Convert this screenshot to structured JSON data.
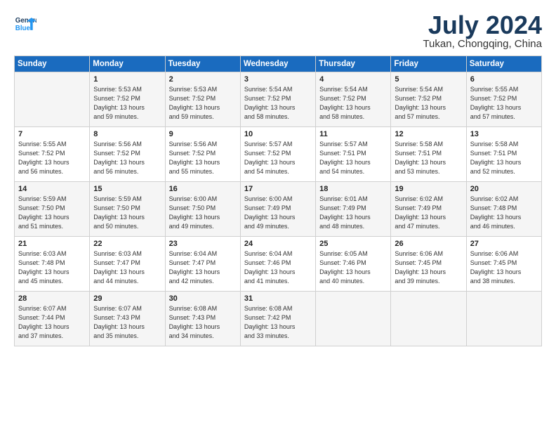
{
  "header": {
    "logo_line1": "General",
    "logo_line2": "Blue",
    "title": "July 2024",
    "location": "Tukan, Chongqing, China"
  },
  "columns": [
    "Sunday",
    "Monday",
    "Tuesday",
    "Wednesday",
    "Thursday",
    "Friday",
    "Saturday"
  ],
  "weeks": [
    [
      {
        "day": "",
        "content": ""
      },
      {
        "day": "1",
        "content": "Sunrise: 5:53 AM\nSunset: 7:52 PM\nDaylight: 13 hours\nand 59 minutes."
      },
      {
        "day": "2",
        "content": "Sunrise: 5:53 AM\nSunset: 7:52 PM\nDaylight: 13 hours\nand 59 minutes."
      },
      {
        "day": "3",
        "content": "Sunrise: 5:54 AM\nSunset: 7:52 PM\nDaylight: 13 hours\nand 58 minutes."
      },
      {
        "day": "4",
        "content": "Sunrise: 5:54 AM\nSunset: 7:52 PM\nDaylight: 13 hours\nand 58 minutes."
      },
      {
        "day": "5",
        "content": "Sunrise: 5:54 AM\nSunset: 7:52 PM\nDaylight: 13 hours\nand 57 minutes."
      },
      {
        "day": "6",
        "content": "Sunrise: 5:55 AM\nSunset: 7:52 PM\nDaylight: 13 hours\nand 57 minutes."
      }
    ],
    [
      {
        "day": "7",
        "content": "Sunrise: 5:55 AM\nSunset: 7:52 PM\nDaylight: 13 hours\nand 56 minutes."
      },
      {
        "day": "8",
        "content": "Sunrise: 5:56 AM\nSunset: 7:52 PM\nDaylight: 13 hours\nand 56 minutes."
      },
      {
        "day": "9",
        "content": "Sunrise: 5:56 AM\nSunset: 7:52 PM\nDaylight: 13 hours\nand 55 minutes."
      },
      {
        "day": "10",
        "content": "Sunrise: 5:57 AM\nSunset: 7:52 PM\nDaylight: 13 hours\nand 54 minutes."
      },
      {
        "day": "11",
        "content": "Sunrise: 5:57 AM\nSunset: 7:51 PM\nDaylight: 13 hours\nand 54 minutes."
      },
      {
        "day": "12",
        "content": "Sunrise: 5:58 AM\nSunset: 7:51 PM\nDaylight: 13 hours\nand 53 minutes."
      },
      {
        "day": "13",
        "content": "Sunrise: 5:58 AM\nSunset: 7:51 PM\nDaylight: 13 hours\nand 52 minutes."
      }
    ],
    [
      {
        "day": "14",
        "content": "Sunrise: 5:59 AM\nSunset: 7:50 PM\nDaylight: 13 hours\nand 51 minutes."
      },
      {
        "day": "15",
        "content": "Sunrise: 5:59 AM\nSunset: 7:50 PM\nDaylight: 13 hours\nand 50 minutes."
      },
      {
        "day": "16",
        "content": "Sunrise: 6:00 AM\nSunset: 7:50 PM\nDaylight: 13 hours\nand 49 minutes."
      },
      {
        "day": "17",
        "content": "Sunrise: 6:00 AM\nSunset: 7:49 PM\nDaylight: 13 hours\nand 49 minutes."
      },
      {
        "day": "18",
        "content": "Sunrise: 6:01 AM\nSunset: 7:49 PM\nDaylight: 13 hours\nand 48 minutes."
      },
      {
        "day": "19",
        "content": "Sunrise: 6:02 AM\nSunset: 7:49 PM\nDaylight: 13 hours\nand 47 minutes."
      },
      {
        "day": "20",
        "content": "Sunrise: 6:02 AM\nSunset: 7:48 PM\nDaylight: 13 hours\nand 46 minutes."
      }
    ],
    [
      {
        "day": "21",
        "content": "Sunrise: 6:03 AM\nSunset: 7:48 PM\nDaylight: 13 hours\nand 45 minutes."
      },
      {
        "day": "22",
        "content": "Sunrise: 6:03 AM\nSunset: 7:47 PM\nDaylight: 13 hours\nand 44 minutes."
      },
      {
        "day": "23",
        "content": "Sunrise: 6:04 AM\nSunset: 7:47 PM\nDaylight: 13 hours\nand 42 minutes."
      },
      {
        "day": "24",
        "content": "Sunrise: 6:04 AM\nSunset: 7:46 PM\nDaylight: 13 hours\nand 41 minutes."
      },
      {
        "day": "25",
        "content": "Sunrise: 6:05 AM\nSunset: 7:46 PM\nDaylight: 13 hours\nand 40 minutes."
      },
      {
        "day": "26",
        "content": "Sunrise: 6:06 AM\nSunset: 7:45 PM\nDaylight: 13 hours\nand 39 minutes."
      },
      {
        "day": "27",
        "content": "Sunrise: 6:06 AM\nSunset: 7:45 PM\nDaylight: 13 hours\nand 38 minutes."
      }
    ],
    [
      {
        "day": "28",
        "content": "Sunrise: 6:07 AM\nSunset: 7:44 PM\nDaylight: 13 hours\nand 37 minutes."
      },
      {
        "day": "29",
        "content": "Sunrise: 6:07 AM\nSunset: 7:43 PM\nDaylight: 13 hours\nand 35 minutes."
      },
      {
        "day": "30",
        "content": "Sunrise: 6:08 AM\nSunset: 7:43 PM\nDaylight: 13 hours\nand 34 minutes."
      },
      {
        "day": "31",
        "content": "Sunrise: 6:08 AM\nSunset: 7:42 PM\nDaylight: 13 hours\nand 33 minutes."
      },
      {
        "day": "",
        "content": ""
      },
      {
        "day": "",
        "content": ""
      },
      {
        "day": "",
        "content": ""
      }
    ]
  ]
}
